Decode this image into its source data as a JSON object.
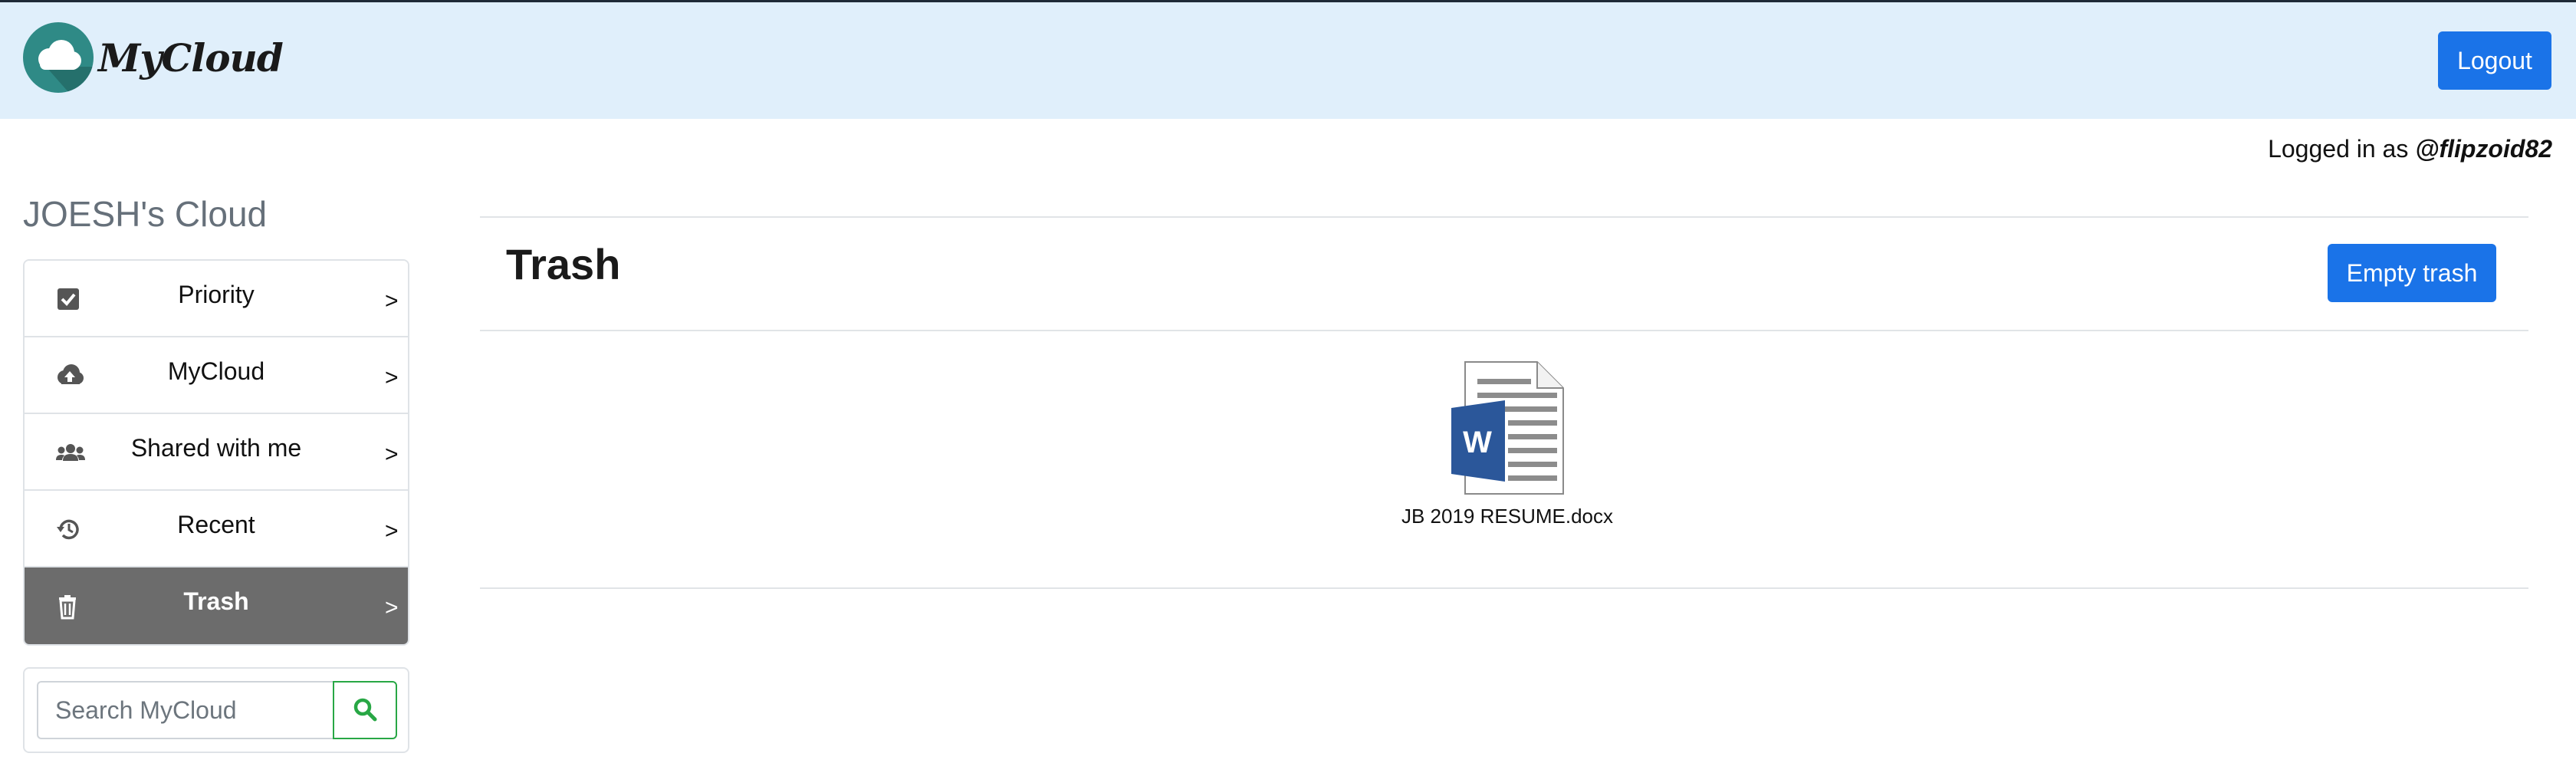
{
  "header": {
    "brand": "MyCloud",
    "logout_label": "Logout"
  },
  "session": {
    "prefix": "Logged in as ",
    "username": "@flipzoid82"
  },
  "sidebar": {
    "title": "JOESH's Cloud",
    "items": [
      {
        "label": "Priority",
        "icon": "check-square-icon",
        "arrow": ">"
      },
      {
        "label": "MyCloud",
        "icon": "cloud-upload-icon",
        "arrow": ">"
      },
      {
        "label": "Shared with me",
        "icon": "users-icon",
        "arrow": ">"
      },
      {
        "label": "Recent",
        "icon": "history-icon",
        "arrow": ">"
      },
      {
        "label": "Trash",
        "icon": "trash-icon",
        "arrow": ">",
        "active": true
      }
    ],
    "search": {
      "placeholder": "Search MyCloud",
      "value": ""
    }
  },
  "main": {
    "title": "Trash",
    "empty_label": "Empty trash",
    "files": [
      {
        "name": "JB 2019 RESUME.docx",
        "type": "word-document-icon"
      }
    ]
  },
  "colors": {
    "header_bg": "#e0effb",
    "primary": "#1a73e8",
    "active_nav": "#6c6c6c",
    "search_accent": "#28a745",
    "word_blue": "#2b579a"
  }
}
